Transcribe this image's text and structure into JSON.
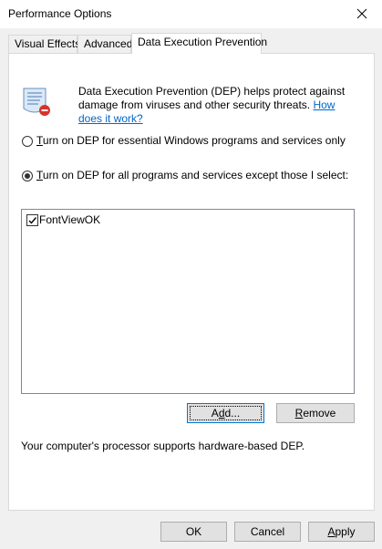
{
  "window": {
    "title": "Performance Options"
  },
  "tabs": [
    {
      "label": "Visual Effects"
    },
    {
      "label": "Advanced"
    },
    {
      "label": "Data Execution Prevention"
    }
  ],
  "dep": {
    "description": "Data Execution Prevention (DEP) helps protect against damage from viruses and other security threats.",
    "link_text": "How does it work?",
    "option_essential_prefix": "T",
    "option_essential_rest": "urn on DEP for essential Windows programs and services only",
    "option_all_prefix": "T",
    "option_all_rest": "urn on DEP for all programs and services except those I select:",
    "selected_option": "all",
    "programs": [
      {
        "name": "FontViewOK",
        "checked": true
      }
    ],
    "add_label_prefix": "A",
    "add_label_u": "d",
    "add_label_rest": "d...",
    "remove_prefix": "",
    "remove_u": "R",
    "remove_rest": "emove",
    "status": "Your computer's processor supports hardware-based DEP."
  },
  "footer": {
    "ok": "OK",
    "cancel": "Cancel",
    "apply_u": "A",
    "apply_rest": "pply"
  }
}
